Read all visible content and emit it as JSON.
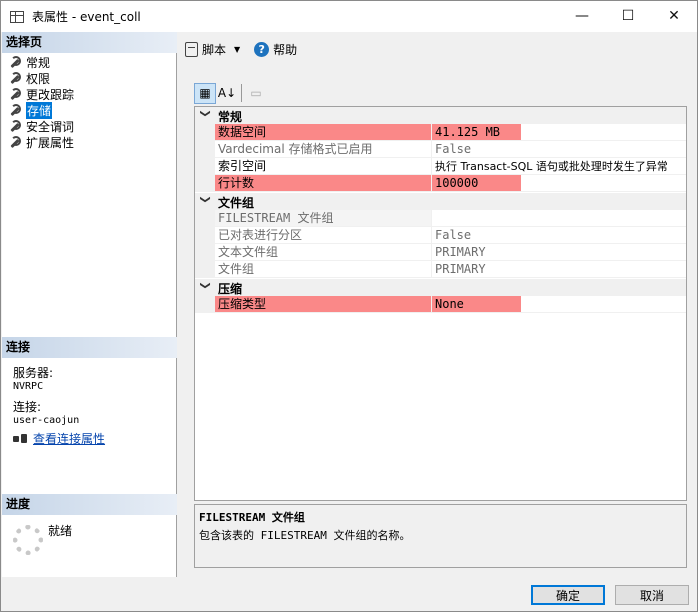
{
  "window": {
    "title": "表属性 - event_coll",
    "minimize": "—",
    "maximize": "☐",
    "close": "✕"
  },
  "left": {
    "select_page_header": "选择页",
    "pages": [
      {
        "label": "常规"
      },
      {
        "label": "权限"
      },
      {
        "label": "更改跟踪"
      },
      {
        "label": "存储",
        "selected": true
      },
      {
        "label": "安全谓词"
      },
      {
        "label": "扩展属性"
      }
    ],
    "connection_header": "连接",
    "server_label": "服务器:",
    "server_value": "NVRPC",
    "connection_label": "连接:",
    "connection_value": "user-caojun",
    "view_connection_link": "查看连接属性",
    "progress_header": "进度",
    "progress_status": "就绪"
  },
  "toolbar": {
    "script_label": "脚本",
    "help_label": "帮助"
  },
  "grid": {
    "categories": [
      {
        "label": "常规",
        "rows": [
          {
            "name": "数据空间",
            "value": "41.125 MB",
            "highlight": true,
            "dim": false
          },
          {
            "name": "Vardecimal 存储格式已启用",
            "value": "False",
            "highlight": false,
            "dim": true
          },
          {
            "name": "索引空间",
            "value": "执行 Transact-SQL 语句或批处理时发生了异常",
            "highlight": false,
            "dim": false
          },
          {
            "name": "行计数",
            "value": "100000",
            "highlight": true,
            "dim": false
          }
        ]
      },
      {
        "label": "文件组",
        "rows": [
          {
            "name": "FILESTREAM 文件组",
            "value": "",
            "highlight": false,
            "dim": true
          },
          {
            "name": "已对表进行分区",
            "value": "False",
            "highlight": false,
            "dim": true
          },
          {
            "name": "文本文件组",
            "value": "PRIMARY",
            "highlight": false,
            "dim": true
          },
          {
            "name": "文件组",
            "value": "PRIMARY",
            "highlight": false,
            "dim": true
          }
        ]
      },
      {
        "label": "压缩",
        "rows": [
          {
            "name": "压缩类型",
            "value": "None",
            "highlight": true,
            "dim": false
          }
        ]
      }
    ]
  },
  "description": {
    "title": "FILESTREAM 文件组",
    "text": "包含该表的 FILESTREAM 文件组的名称。"
  },
  "buttons": {
    "ok": "确定",
    "cancel": "取消"
  },
  "colors": {
    "highlight": "#fa7e7e",
    "selection": "#0078d7",
    "link": "#0645ad"
  }
}
